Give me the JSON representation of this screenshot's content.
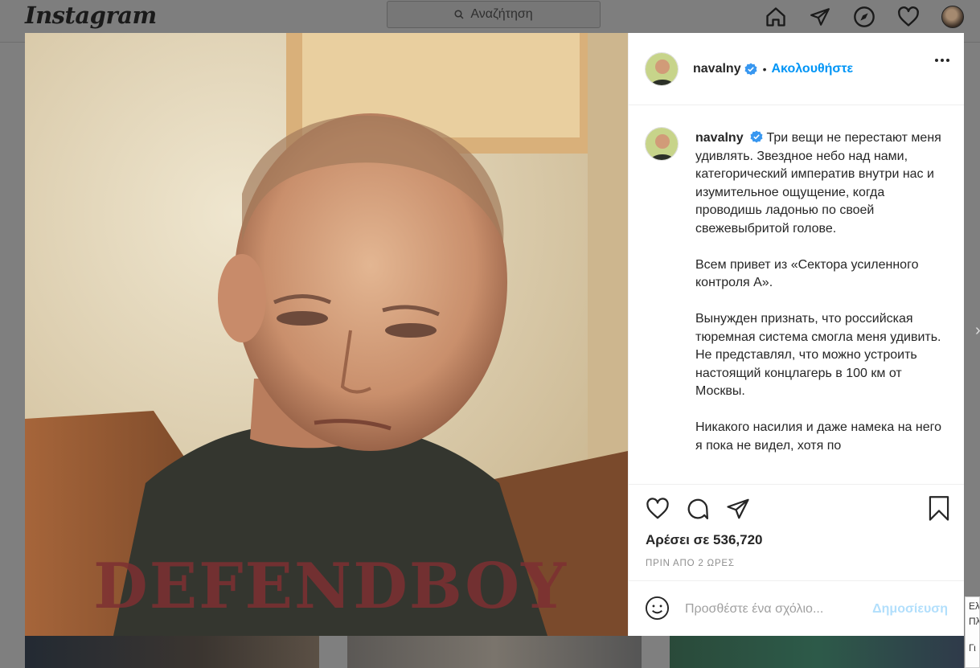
{
  "header": {
    "logo": "Instagram",
    "search_placeholder": "Αναζήτηση",
    "nav_icons": [
      "home-icon",
      "direct-icon",
      "explore-icon",
      "activity-heart-icon",
      "profile-avatar"
    ]
  },
  "post": {
    "username": "navalny",
    "verified": true,
    "follow_label": "Ακολουθήστε",
    "caption_paragraphs": [
      "Три вещи не перестают меня удивлять. Звездное небо над нами, категорический императив внутри нас и изумительное ощущение, когда проводишь ладонью по своей свежевыбритой голове.",
      "Всем привет из «Сектора усиленного контроля А».",
      "Вынужден признать, что российская тюремная система смогла меня удивить. Не представлял, что можно устроить настоящий концлагерь в 100 км от Москвы.",
      "Никакого насилия и даже намека на него я пока не видел, хотя по"
    ],
    "likes": "Αρέσει σε 536,720",
    "time_ago": "ΠΡΙΝ ΑΠΟ 2 ΩΡΕΣ",
    "shirt_text": "DEFENDBOY"
  },
  "comment_box": {
    "placeholder": "Προσθέστε ένα σχόλιο...",
    "post_label": "Δημοσίευση"
  },
  "side_popup": {
    "line1": "Ελ",
    "line2": "Πλ",
    "line3": "Γι"
  },
  "colors": {
    "accent": "#0095f6",
    "post_disabled": "#b2dffc",
    "verified_badge": "#3897f0",
    "overlay": "#7f7f7f"
  }
}
